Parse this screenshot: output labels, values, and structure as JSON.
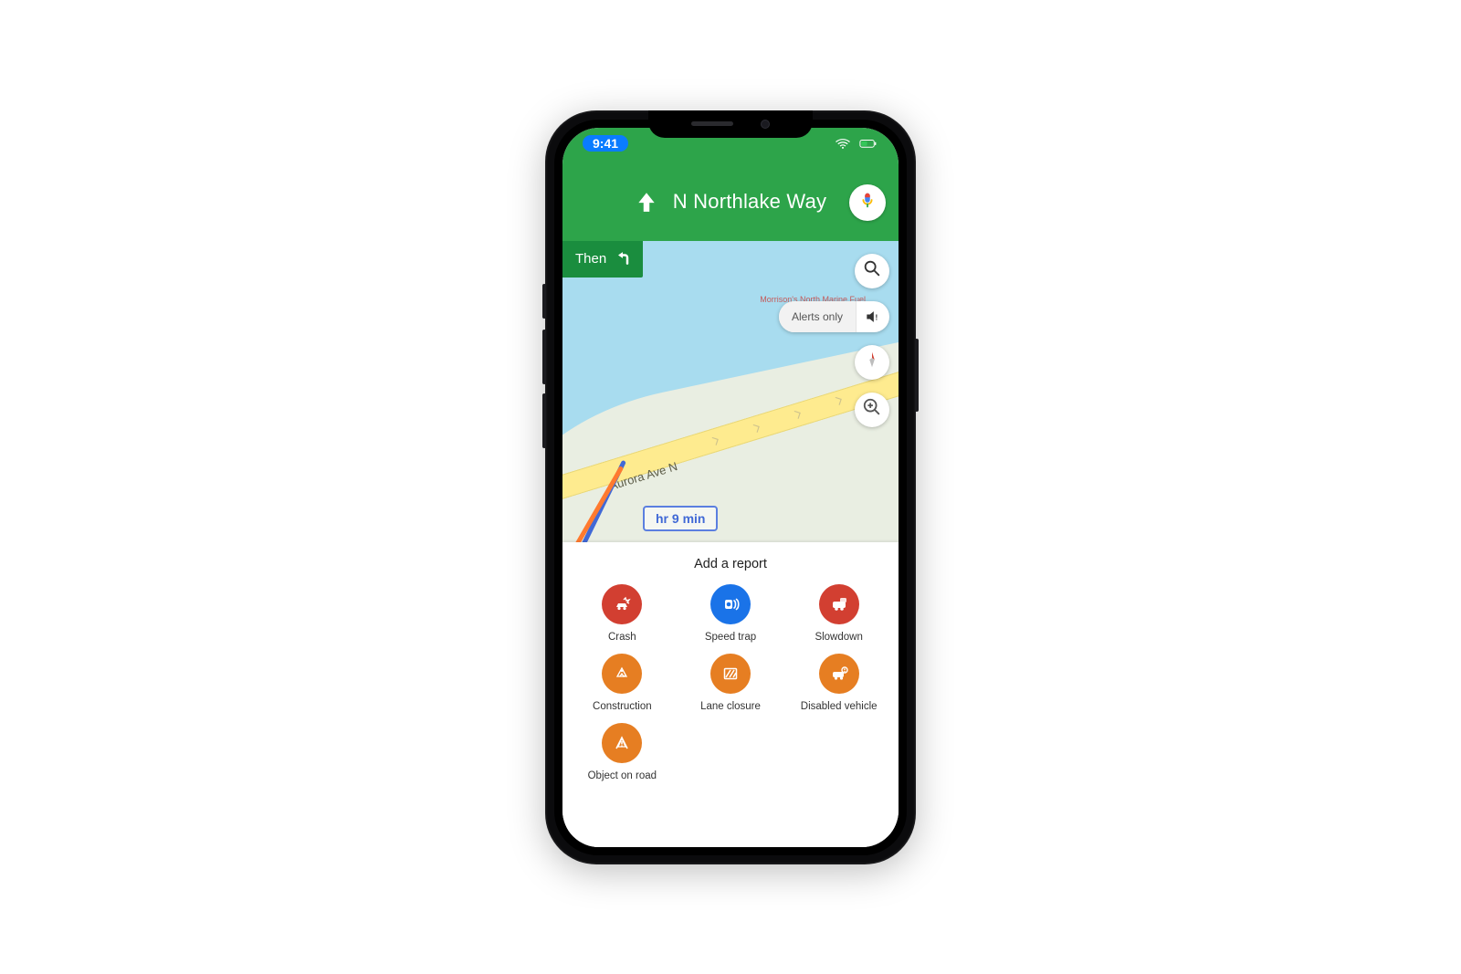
{
  "status": {
    "time": "9:41"
  },
  "nav": {
    "road_name": "N Northlake Way",
    "then_label": "Then"
  },
  "map": {
    "road_label": "Aurora Ave N",
    "eta_label": "hr 9 min",
    "poi_name": "Morrison's North\nMarine Fuel",
    "alerts_label": "Alerts only"
  },
  "sheet": {
    "title": "Add a report",
    "items": [
      {
        "key": "crash",
        "label": "Crash",
        "color": "red",
        "icon": "crash"
      },
      {
        "key": "speed-trap",
        "label": "Speed trap",
        "color": "blue",
        "icon": "speedtrap"
      },
      {
        "key": "slowdown",
        "label": "Slowdown",
        "color": "red",
        "icon": "slowdown"
      },
      {
        "key": "construction",
        "label": "Construction",
        "color": "orange",
        "icon": "construction"
      },
      {
        "key": "lane-closure",
        "label": "Lane closure",
        "color": "orange",
        "icon": "laneclosure"
      },
      {
        "key": "disabled-vehicle",
        "label": "Disabled vehicle",
        "color": "orange",
        "icon": "disabled"
      },
      {
        "key": "object-on-road",
        "label": "Object on road",
        "color": "orange",
        "icon": "object"
      }
    ]
  }
}
